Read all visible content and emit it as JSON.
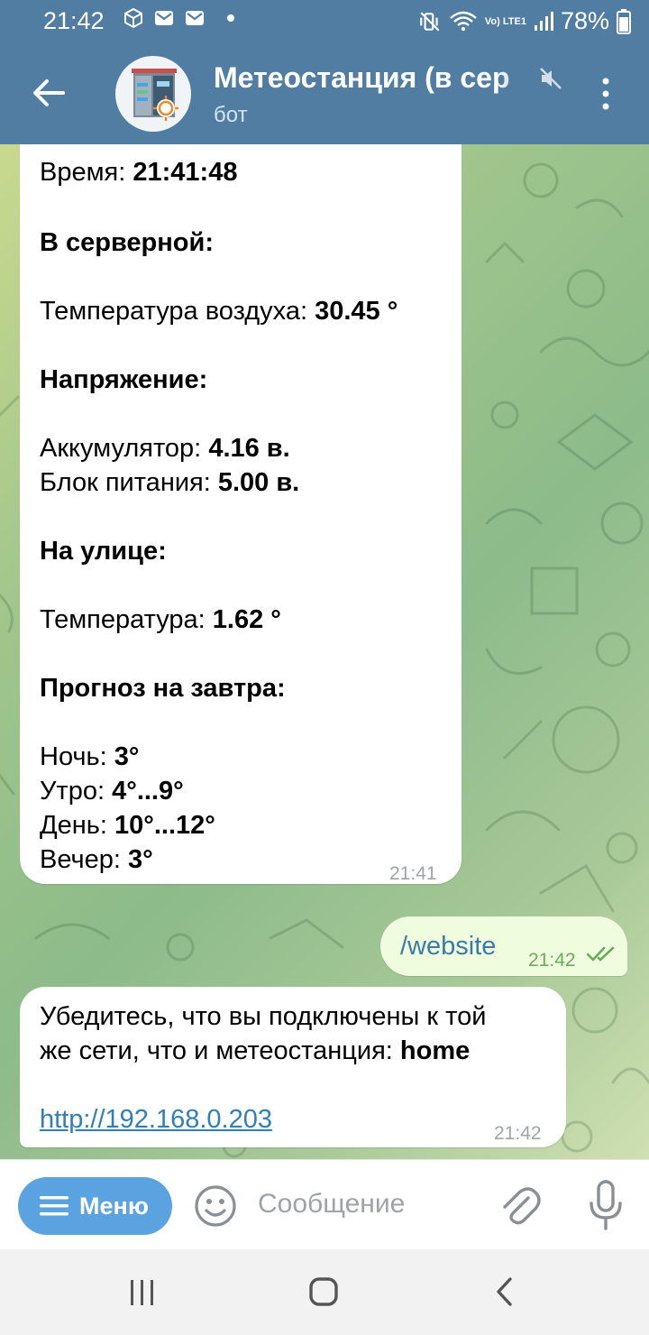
{
  "status_bar": {
    "time": "21:42",
    "network": "Vo) LTE1",
    "battery": "78%"
  },
  "header": {
    "title": "Метеостанция (в сер",
    "subtitle": "бот"
  },
  "messages": {
    "report": {
      "time_label": "Время:",
      "time_value": "21:41:48",
      "server_heading": "В серверной:",
      "air_temp_label": "Температура воздуха:",
      "air_temp_value": "30.45 °",
      "voltage_heading": "Напряжение:",
      "battery_label": "Аккумулятор:",
      "battery_value": "4.16 в.",
      "psu_label": "Блок питания:",
      "psu_value": "5.00 в.",
      "outside_heading": "На улице:",
      "outside_temp_label": "Температура:",
      "outside_temp_value": "1.62 °",
      "forecast_heading": "Прогноз на завтра:",
      "night_label": "Ночь:",
      "night_value": "3°",
      "morning_label": "Утро:",
      "morning_value": "4°...9°",
      "day_label": "День:",
      "day_value": "10°...12°",
      "evening_label": "Вечер:",
      "evening_value": "3°",
      "timestamp": "21:41"
    },
    "command": {
      "text": "/website",
      "timestamp": "21:42"
    },
    "reply": {
      "line1": "Убедитесь, что вы подключены к той",
      "line2_prefix": "же сети, что и метеостанция:",
      "line2_bold": "home",
      "link": "http://192.168.0.203",
      "timestamp": "21:42"
    }
  },
  "input_bar": {
    "menu_label": "Меню",
    "placeholder": "Сообщение"
  },
  "colors": {
    "header_bg": "#517da2",
    "menu_button": "#5aa3e0",
    "outgoing_bubble": "#effdde",
    "link": "#2f7fb8"
  }
}
